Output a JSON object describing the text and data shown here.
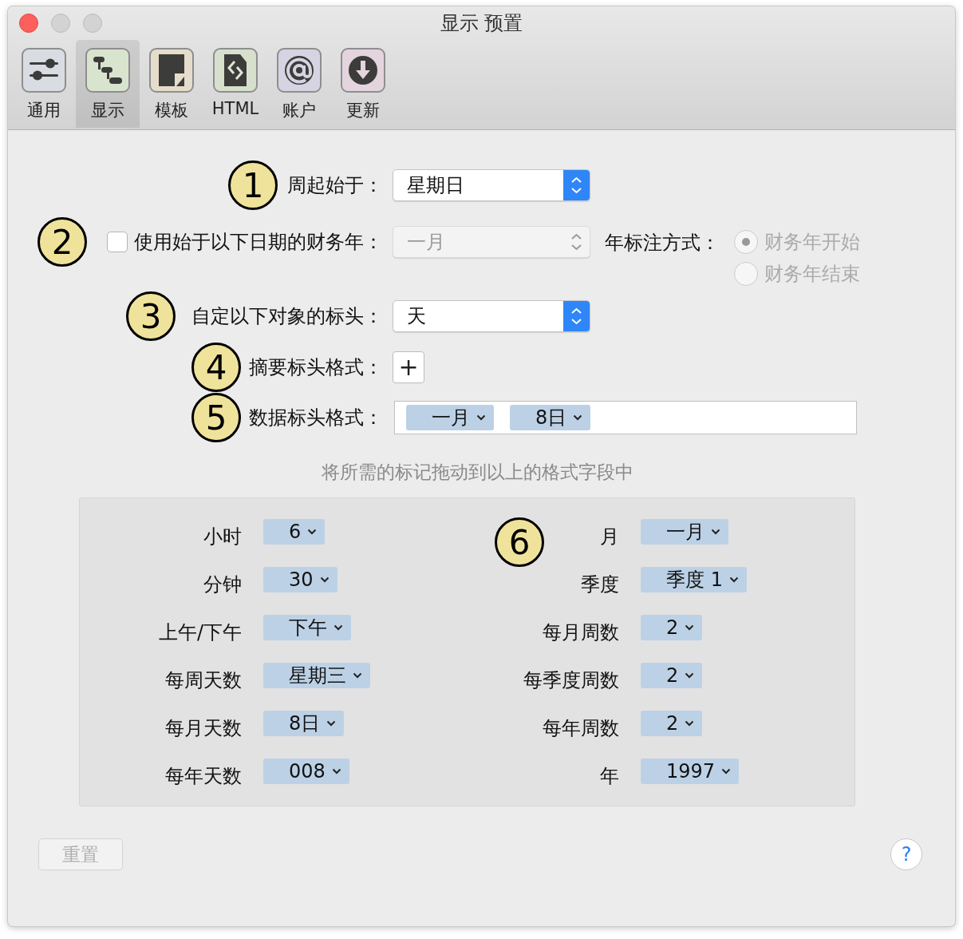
{
  "window": {
    "title": "显示 预置"
  },
  "toolbar": [
    {
      "label": "通用",
      "kind": "sliders",
      "selected": false
    },
    {
      "label": "显示",
      "kind": "steps",
      "selected": true
    },
    {
      "label": "模板",
      "kind": "document",
      "selected": false
    },
    {
      "label": "HTML",
      "kind": "code",
      "selected": false
    },
    {
      "label": "账户",
      "kind": "at",
      "selected": false
    },
    {
      "label": "更新",
      "kind": "download",
      "selected": false
    }
  ],
  "week_start": {
    "callout": "1",
    "label": "周起始于：",
    "value": "星期日"
  },
  "fiscal_year": {
    "callout": "2",
    "label": "使用始于以下日期的财务年：",
    "checked": false,
    "value": "一月",
    "disabled": true
  },
  "year_notation": {
    "label": "年标注方式：",
    "disabled": true,
    "options": [
      {
        "label": "财务年开始",
        "selected": true
      },
      {
        "label": "财务年结束",
        "selected": false
      }
    ]
  },
  "custom_header": {
    "callout": "3",
    "label": "自定以下对象的标头：",
    "value": "天"
  },
  "summary_format": {
    "callout": "4",
    "label": "摘要标头格式：",
    "button": "+"
  },
  "data_format": {
    "callout": "5",
    "label": "数据标头格式：",
    "tokens": [
      "一月",
      "8日"
    ]
  },
  "hint": "将所需的标记拖动到以上的格式字段中",
  "token_panel": {
    "callout": "6",
    "left": [
      {
        "label": "小时",
        "value": "6"
      },
      {
        "label": "分钟",
        "value": "30"
      },
      {
        "label": "上午/下午",
        "value": "下午"
      },
      {
        "label": "每周天数",
        "value": "星期三"
      },
      {
        "label": "每月天数",
        "value": "8日"
      },
      {
        "label": "每年天数",
        "value": "008"
      }
    ],
    "right": [
      {
        "label": "月",
        "value": "一月"
      },
      {
        "label": "季度",
        "value": "季度 1"
      },
      {
        "label": "每月周数",
        "value": "2"
      },
      {
        "label": "每季度周数",
        "value": "2"
      },
      {
        "label": "每年周数",
        "value": "2"
      },
      {
        "label": "年",
        "value": "1997"
      }
    ]
  },
  "reset_button": {
    "label": "重置",
    "disabled": true
  },
  "help_button": "?"
}
